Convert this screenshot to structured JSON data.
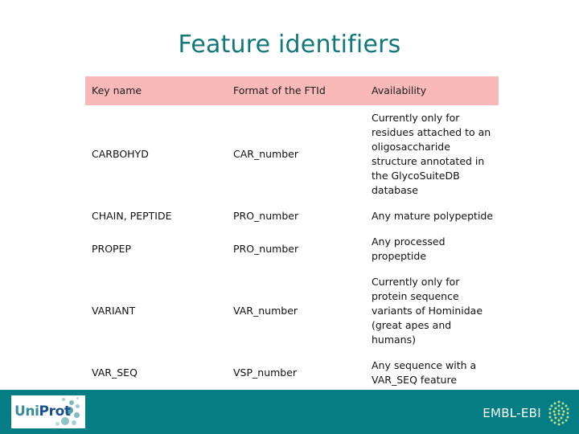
{
  "slide": {
    "title": "Feature identifiers",
    "background_color": "#ffffff",
    "title_color": "#11787a"
  },
  "table": {
    "header_background": "#fab9b9",
    "headers": {
      "key_name": "Key name",
      "format": "Format of the FTId",
      "availability": "Availability"
    },
    "rows": [
      {
        "key_name": "CARBOHYD",
        "format": "CAR_number",
        "availability": "Currently only for residues attached to an oligosaccharide structure annotated in the GlycoSuiteDB database"
      },
      {
        "key_name": "CHAIN, PEPTIDE",
        "format": "PRO_number",
        "availability": "Any mature polypeptide"
      },
      {
        "key_name": "PROPEP",
        "format": "PRO_number",
        "availability": "Any processed propeptide"
      },
      {
        "key_name": "VARIANT",
        "format": "VAR_number",
        "availability": "Currently only for protein sequence variants of Hominidae (great apes and humans)"
      },
      {
        "key_name": "VAR_SEQ",
        "format": "VSP_number",
        "availability": "Any sequence with a VAR_SEQ feature"
      }
    ]
  },
  "footer": {
    "background_color": "#047d84",
    "uniprot_logo": {
      "text_uni": "Uni",
      "text_prot": "Prot",
      "uni_color": "#3a8c96",
      "prot_color": "#1a4f8f"
    },
    "embl_ebi": {
      "label": "EMBL-EBI",
      "label_color": "#ffffff",
      "mark_color": "#b9e08f"
    }
  }
}
